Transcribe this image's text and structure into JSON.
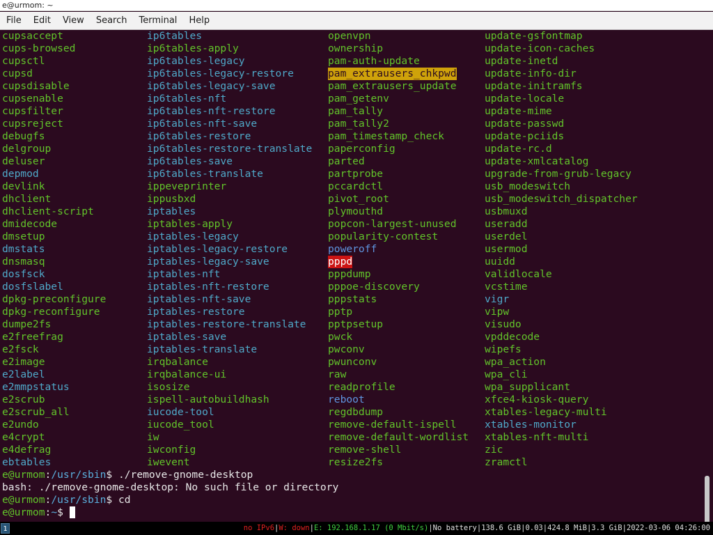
{
  "window": {
    "title": "e@urmom: ~"
  },
  "menu": [
    "File",
    "Edit",
    "View",
    "Search",
    "Terminal",
    "Help"
  ],
  "listing": {
    "columns": [
      [
        {
          "t": "cupsaccept",
          "s": "g"
        },
        {
          "t": "cups-browsed",
          "s": "g"
        },
        {
          "t": "cupsctl",
          "s": "g"
        },
        {
          "t": "cupsd",
          "s": "g"
        },
        {
          "t": "cupsdisable",
          "s": "g"
        },
        {
          "t": "cupsenable",
          "s": "g"
        },
        {
          "t": "cupsfilter",
          "s": "g"
        },
        {
          "t": "cupsreject",
          "s": "g"
        },
        {
          "t": "debugfs",
          "s": "g"
        },
        {
          "t": "delgroup",
          "s": "g"
        },
        {
          "t": "deluser",
          "s": "g"
        },
        {
          "t": "depmod",
          "s": "c"
        },
        {
          "t": "devlink",
          "s": "g"
        },
        {
          "t": "dhclient",
          "s": "g"
        },
        {
          "t": "dhclient-script",
          "s": "g"
        },
        {
          "t": "dmidecode",
          "s": "g"
        },
        {
          "t": "dmsetup",
          "s": "g"
        },
        {
          "t": "dmstats",
          "s": "c"
        },
        {
          "t": "dnsmasq",
          "s": "g"
        },
        {
          "t": "dosfsck",
          "s": "c"
        },
        {
          "t": "dosfslabel",
          "s": "c"
        },
        {
          "t": "dpkg-preconfigure",
          "s": "g"
        },
        {
          "t": "dpkg-reconfigure",
          "s": "g"
        },
        {
          "t": "dumpe2fs",
          "s": "g"
        },
        {
          "t": "e2freefrag",
          "s": "g"
        },
        {
          "t": "e2fsck",
          "s": "g"
        },
        {
          "t": "e2image",
          "s": "g"
        },
        {
          "t": "e2label",
          "s": "c"
        },
        {
          "t": "e2mmpstatus",
          "s": "c"
        },
        {
          "t": "e2scrub",
          "s": "g"
        },
        {
          "t": "e2scrub_all",
          "s": "g"
        },
        {
          "t": "e2undo",
          "s": "g"
        },
        {
          "t": "e4crypt",
          "s": "g"
        },
        {
          "t": "e4defrag",
          "s": "g"
        },
        {
          "t": "ebtables",
          "s": "c"
        }
      ],
      [
        {
          "t": "ip6tables",
          "s": "c"
        },
        {
          "t": "ip6tables-apply",
          "s": "g"
        },
        {
          "t": "ip6tables-legacy",
          "s": "c"
        },
        {
          "t": "ip6tables-legacy-restore",
          "s": "c"
        },
        {
          "t": "ip6tables-legacy-save",
          "s": "c"
        },
        {
          "t": "ip6tables-nft",
          "s": "c"
        },
        {
          "t": "ip6tables-nft-restore",
          "s": "c"
        },
        {
          "t": "ip6tables-nft-save",
          "s": "c"
        },
        {
          "t": "ip6tables-restore",
          "s": "c"
        },
        {
          "t": "ip6tables-restore-translate",
          "s": "c"
        },
        {
          "t": "ip6tables-save",
          "s": "c"
        },
        {
          "t": "ip6tables-translate",
          "s": "c"
        },
        {
          "t": "ippeveprinter",
          "s": "g"
        },
        {
          "t": "ippusbxd",
          "s": "g"
        },
        {
          "t": "iptables",
          "s": "c"
        },
        {
          "t": "iptables-apply",
          "s": "g"
        },
        {
          "t": "iptables-legacy",
          "s": "c"
        },
        {
          "t": "iptables-legacy-restore",
          "s": "c"
        },
        {
          "t": "iptables-legacy-save",
          "s": "c"
        },
        {
          "t": "iptables-nft",
          "s": "c"
        },
        {
          "t": "iptables-nft-restore",
          "s": "c"
        },
        {
          "t": "iptables-nft-save",
          "s": "c"
        },
        {
          "t": "iptables-restore",
          "s": "c"
        },
        {
          "t": "iptables-restore-translate",
          "s": "c"
        },
        {
          "t": "iptables-save",
          "s": "c"
        },
        {
          "t": "iptables-translate",
          "s": "c"
        },
        {
          "t": "irqbalance",
          "s": "g"
        },
        {
          "t": "irqbalance-ui",
          "s": "g"
        },
        {
          "t": "isosize",
          "s": "g"
        },
        {
          "t": "ispell-autobuildhash",
          "s": "g"
        },
        {
          "t": "iucode-tool",
          "s": "c"
        },
        {
          "t": "iucode_tool",
          "s": "g"
        },
        {
          "t": "iw",
          "s": "g"
        },
        {
          "t": "iwconfig",
          "s": "g"
        },
        {
          "t": "iwevent",
          "s": "g"
        }
      ],
      [
        {
          "t": "openvpn",
          "s": "g"
        },
        {
          "t": "ownership",
          "s": "g"
        },
        {
          "t": "pam-auth-update",
          "s": "g"
        },
        {
          "t": "pam_extrausers_chkpwd",
          "s": "y"
        },
        {
          "t": "pam_extrausers_update",
          "s": "g"
        },
        {
          "t": "pam_getenv",
          "s": "g"
        },
        {
          "t": "pam_tally",
          "s": "g"
        },
        {
          "t": "pam_tally2",
          "s": "g"
        },
        {
          "t": "pam_timestamp_check",
          "s": "g"
        },
        {
          "t": "paperconfig",
          "s": "g"
        },
        {
          "t": "parted",
          "s": "g"
        },
        {
          "t": "partprobe",
          "s": "g"
        },
        {
          "t": "pccardctl",
          "s": "g"
        },
        {
          "t": "pivot_root",
          "s": "g"
        },
        {
          "t": "plymouthd",
          "s": "g"
        },
        {
          "t": "popcon-largest-unused",
          "s": "g"
        },
        {
          "t": "popularity-contest",
          "s": "g"
        },
        {
          "t": "poweroff",
          "s": "b"
        },
        {
          "t": "pppd",
          "s": "r"
        },
        {
          "t": "pppdump",
          "s": "g"
        },
        {
          "t": "pppoe-discovery",
          "s": "g"
        },
        {
          "t": "pppstats",
          "s": "g"
        },
        {
          "t": "pptp",
          "s": "g"
        },
        {
          "t": "pptpsetup",
          "s": "g"
        },
        {
          "t": "pwck",
          "s": "g"
        },
        {
          "t": "pwconv",
          "s": "g"
        },
        {
          "t": "pwunconv",
          "s": "g"
        },
        {
          "t": "raw",
          "s": "g"
        },
        {
          "t": "readprofile",
          "s": "g"
        },
        {
          "t": "reboot",
          "s": "b"
        },
        {
          "t": "regdbdump",
          "s": "g"
        },
        {
          "t": "remove-default-ispell",
          "s": "g"
        },
        {
          "t": "remove-default-wordlist",
          "s": "g"
        },
        {
          "t": "remove-shell",
          "s": "g"
        },
        {
          "t": "resize2fs",
          "s": "g"
        }
      ],
      [
        {
          "t": "update-gsfontmap",
          "s": "g"
        },
        {
          "t": "update-icon-caches",
          "s": "g"
        },
        {
          "t": "update-inetd",
          "s": "g"
        },
        {
          "t": "update-info-dir",
          "s": "g"
        },
        {
          "t": "update-initramfs",
          "s": "g"
        },
        {
          "t": "update-locale",
          "s": "g"
        },
        {
          "t": "update-mime",
          "s": "g"
        },
        {
          "t": "update-passwd",
          "s": "g"
        },
        {
          "t": "update-pciids",
          "s": "g"
        },
        {
          "t": "update-rc.d",
          "s": "g"
        },
        {
          "t": "update-xmlcatalog",
          "s": "g"
        },
        {
          "t": "upgrade-from-grub-legacy",
          "s": "g"
        },
        {
          "t": "usb_modeswitch",
          "s": "g"
        },
        {
          "t": "usb_modeswitch_dispatcher",
          "s": "g"
        },
        {
          "t": "usbmuxd",
          "s": "g"
        },
        {
          "t": "useradd",
          "s": "g"
        },
        {
          "t": "userdel",
          "s": "g"
        },
        {
          "t": "usermod",
          "s": "g"
        },
        {
          "t": "uuidd",
          "s": "g"
        },
        {
          "t": "validlocale",
          "s": "g"
        },
        {
          "t": "vcstime",
          "s": "g"
        },
        {
          "t": "vigr",
          "s": "c"
        },
        {
          "t": "vipw",
          "s": "g"
        },
        {
          "t": "visudo",
          "s": "g"
        },
        {
          "t": "vpddecode",
          "s": "g"
        },
        {
          "t": "wipefs",
          "s": "g"
        },
        {
          "t": "wpa_action",
          "s": "g"
        },
        {
          "t": "wpa_cli",
          "s": "g"
        },
        {
          "t": "wpa_supplicant",
          "s": "g"
        },
        {
          "t": "xfce4-kiosk-query",
          "s": "g"
        },
        {
          "t": "xtables-legacy-multi",
          "s": "g"
        },
        {
          "t": "xtables-monitor",
          "s": "c"
        },
        {
          "t": "xtables-nft-multi",
          "s": "g"
        },
        {
          "t": "zic",
          "s": "g"
        },
        {
          "t": "zramctl",
          "s": "g"
        }
      ]
    ]
  },
  "session": {
    "prompt_user": "e@urmom",
    "prompt_colon": ":",
    "path_sbin": "/usr/sbin",
    "path_home": "~",
    "prompt_dollar": "$ ",
    "cmd1": "./remove-gnome-desktop",
    "error": "bash: ./remove-gnome-desktop: No such file or directory",
    "cmd2": "cd",
    "cmd3": ""
  },
  "statusbar": {
    "workspace": "1",
    "ipv6": "no IPv6",
    "wireless": "W: down",
    "ethernet": "E: 192.168.1.17 (0 Mbit/s)",
    "battery": "No battery",
    "disk": "138.6 GiB",
    "load": "0.03",
    "memory": "424.8 MiB",
    "swap": "3.3 GiB",
    "datetime": "2022-03-06 04:26:00",
    "separator": "|"
  },
  "colors": {
    "background": "#2b0a1f",
    "executable": "#62c42a",
    "symlink": "#4fa9c9",
    "setuid": "#cfa20a",
    "setgid": "#cc1414",
    "prompt_path": "#5ab0de"
  }
}
